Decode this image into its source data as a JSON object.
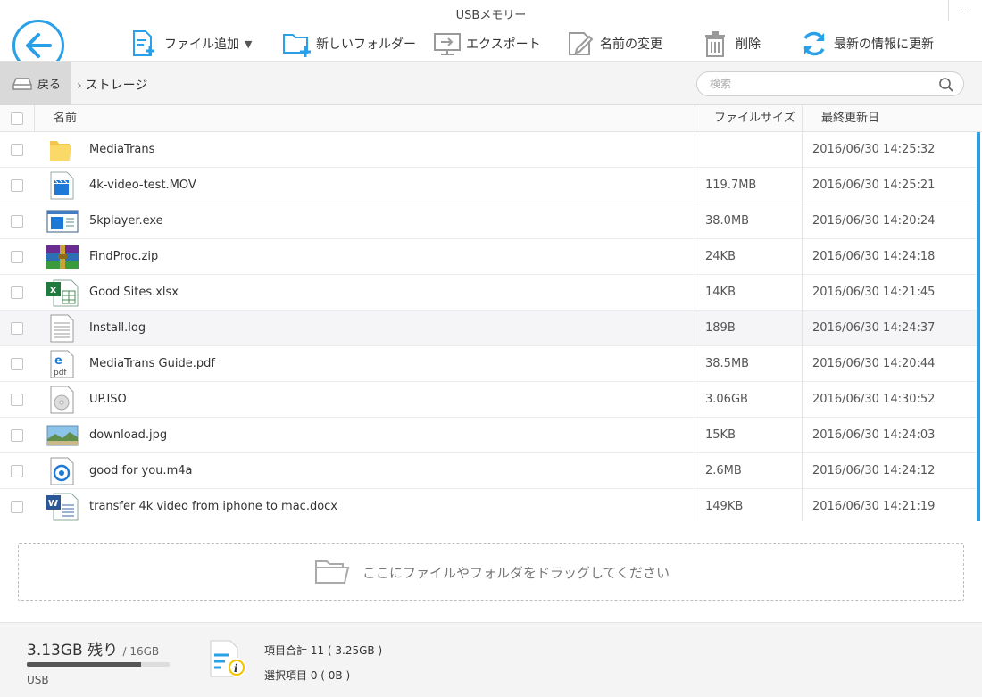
{
  "window": {
    "title": "USBメモリー"
  },
  "toolbar": {
    "add_file": "ファイル追加",
    "new_folder": "新しいフォルダー",
    "export": "エクスポート",
    "rename": "名前の変更",
    "delete": "削除",
    "refresh": "最新の情報に更新"
  },
  "nav": {
    "back": "戻る",
    "breadcrumb": "ストレージ",
    "search_placeholder": "検索"
  },
  "table": {
    "columns": {
      "name": "名前",
      "size": "ファイルサイズ",
      "modified": "最終更新日"
    },
    "rows": [
      {
        "icon": "folder-icon",
        "name": "MediaTrans",
        "size": "",
        "date": "2016/06/30 14:25:32"
      },
      {
        "icon": "video-file-icon",
        "name": "4k-video-test.MOV",
        "size": "119.7MB",
        "date": "2016/06/30 14:25:21"
      },
      {
        "icon": "exe-file-icon",
        "name": "5kplayer.exe",
        "size": "38.0MB",
        "date": "2016/06/30 14:20:24"
      },
      {
        "icon": "zip-file-icon",
        "name": "FindProc.zip",
        "size": "24KB",
        "date": "2016/06/30 14:24:18"
      },
      {
        "icon": "excel-file-icon",
        "name": "Good Sites.xlsx",
        "size": "14KB",
        "date": "2016/06/30 14:21:45"
      },
      {
        "icon": "text-file-icon",
        "name": "Install.log",
        "size": "189B",
        "date": "2016/06/30 14:24:37"
      },
      {
        "icon": "pdf-file-icon",
        "name": "MediaTrans  Guide.pdf",
        "size": "38.5MB",
        "date": "2016/06/30 14:20:44"
      },
      {
        "icon": "iso-file-icon",
        "name": "UP.ISO",
        "size": "3.06GB",
        "date": "2016/06/30 14:30:52"
      },
      {
        "icon": "image-file-icon",
        "name": "download.jpg",
        "size": "15KB",
        "date": "2016/06/30 14:24:03"
      },
      {
        "icon": "audio-file-icon",
        "name": "good for you.m4a",
        "size": "2.6MB",
        "date": "2016/06/30 14:24:12"
      },
      {
        "icon": "word-file-icon",
        "name": "transfer 4k video from iphone to mac.docx",
        "size": "149KB",
        "date": "2016/06/30 14:21:19"
      }
    ],
    "highlighted_row": 5
  },
  "dropzone": {
    "label": "ここにファイルやフォルダをドラッグしてください"
  },
  "footer": {
    "free": "3.13GB 残り",
    "total": "/ 16GB",
    "used_fraction": 0.8,
    "device": "USB",
    "items_total": "項目合計 11 ( 3.25GB )",
    "items_selected": "選択項目 0 ( 0B )"
  },
  "colors": {
    "accent": "#2aa0e8",
    "toolbar_icon": "#2aa0e8",
    "disabled_icon": "#9a9a9a"
  }
}
